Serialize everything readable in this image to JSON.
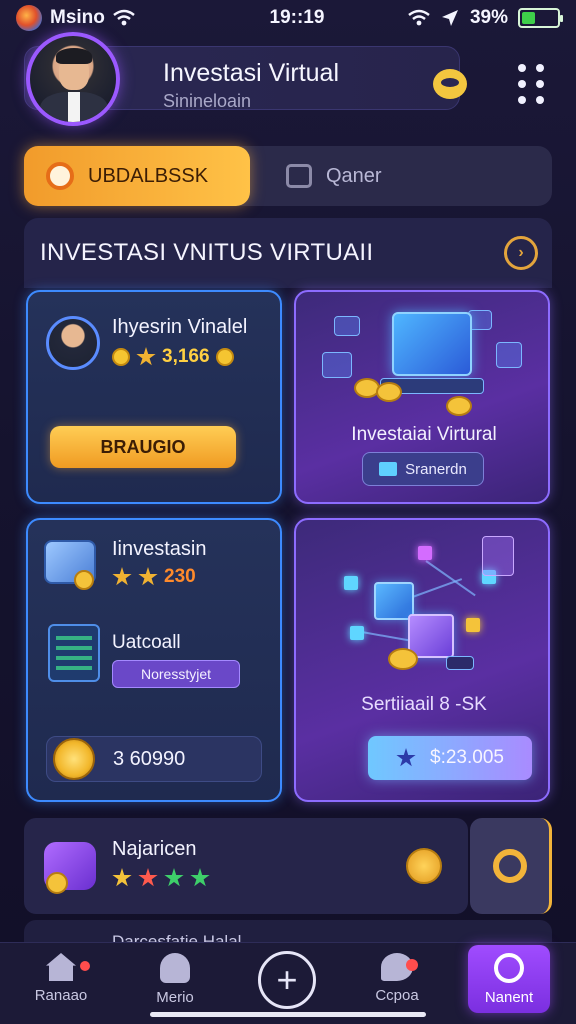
{
  "status_bar": {
    "carrier": "Msino",
    "time": "19::19",
    "battery": "39%",
    "battery_level": 0.39
  },
  "header": {
    "title": "Investasi Virtual",
    "subtitle": "Sinineloain"
  },
  "tabs": [
    {
      "label": "UBDALBSSK",
      "active": true
    },
    {
      "label": "Qaner",
      "active": false
    }
  ],
  "section": {
    "title": "INVESTASI VNITUS VIRTUAII"
  },
  "cards": {
    "profile_card": {
      "title": "Ihyesrin Vinalel",
      "value": "3,166",
      "button": "BRAUGIO"
    },
    "virtual_card": {
      "label": "Investaiai Virtural",
      "button": "Sranerdn"
    },
    "invest_card": {
      "title": "Iinvestasin",
      "value": "230",
      "sub_title": "Uatcoall",
      "tag": "Noresstyjet",
      "amount": "3 60990"
    },
    "network_card": {
      "label": "Sertiiaail 8 -SK",
      "value": "$:23.005"
    }
  },
  "list_item": {
    "title": "Najaricen"
  },
  "peek_item": {
    "text": "Darcesfatie Halal"
  },
  "bottom_nav": [
    {
      "label": "Ranaao"
    },
    {
      "label": "Merio"
    },
    {
      "label": "Ccpoa"
    },
    {
      "label": "Nanent"
    }
  ],
  "colors": {
    "accent_gold": "#f5b43b",
    "accent_purple": "#9b59ff",
    "accent_blue": "#3d8bff",
    "background": "#171532"
  },
  "icons": {
    "status": [
      "carrier-logo-icon",
      "wifi-icon",
      "location-arrow-icon",
      "battery-icon"
    ],
    "header": [
      "avatar-icon",
      "chat-bubble-icon",
      "kebab-menu-icon"
    ],
    "nav": [
      "home-icon",
      "market-icon",
      "plus-icon",
      "chat-icon",
      "gender-icon"
    ]
  }
}
